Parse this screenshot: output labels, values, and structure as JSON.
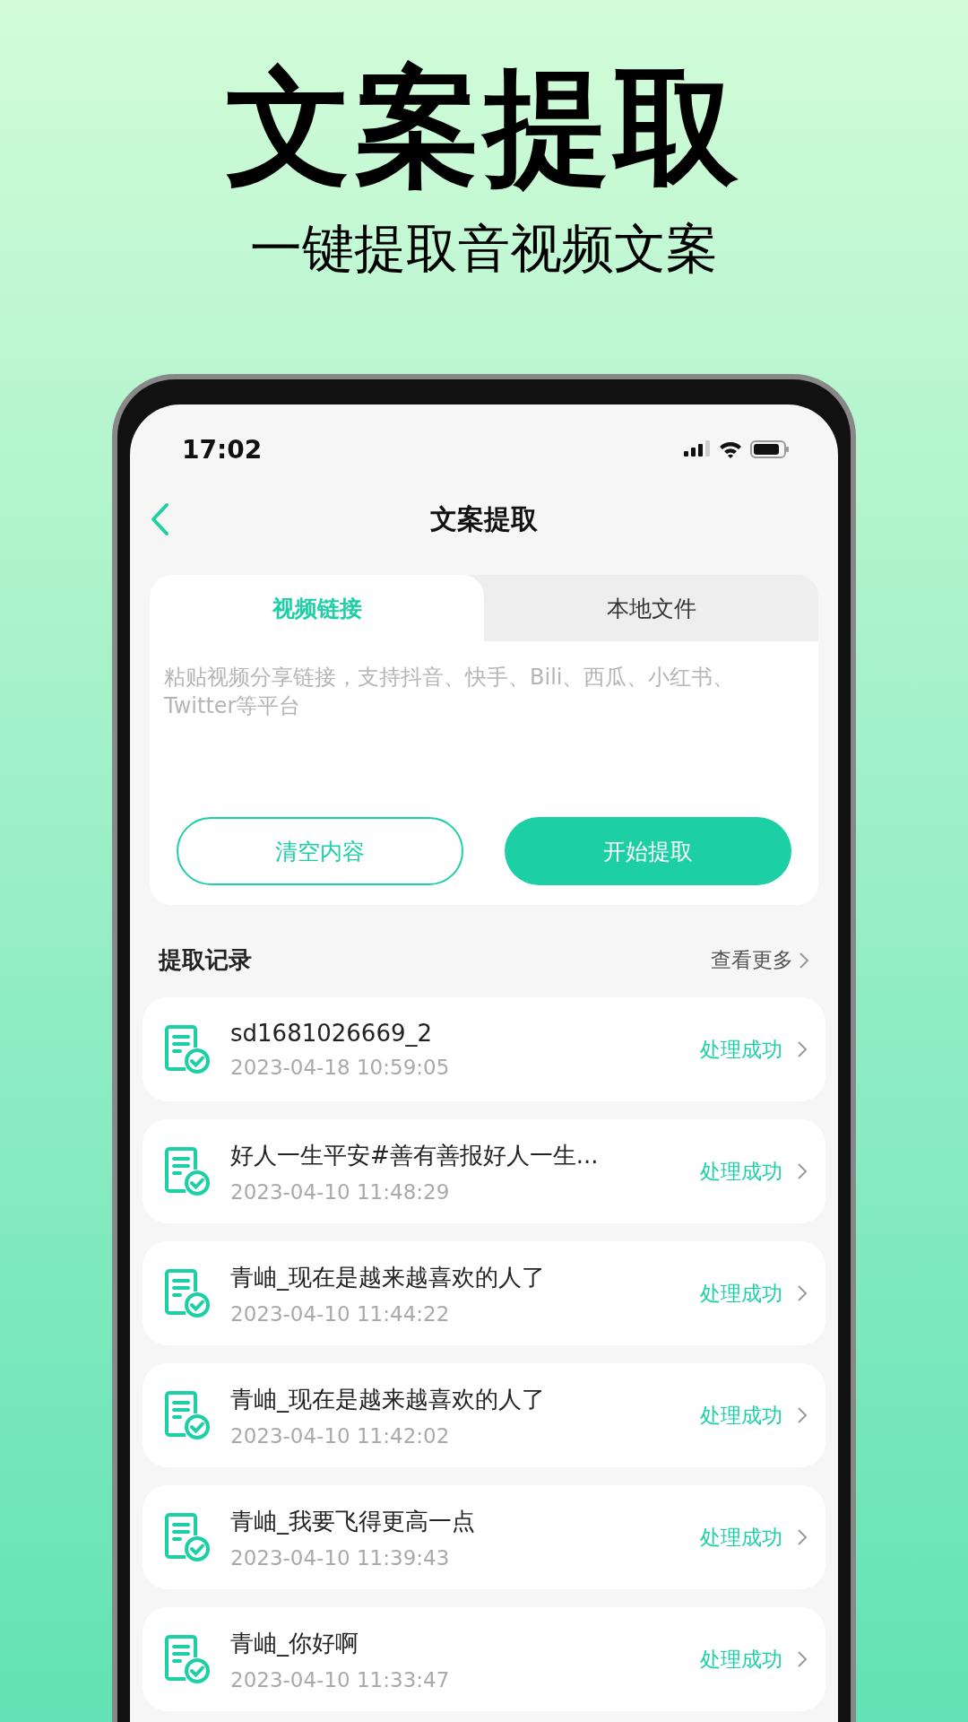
{
  "promo": {
    "headline": "文案提取",
    "subtitle": "一键提取音视频文案"
  },
  "status_bar": {
    "time": "17:02"
  },
  "nav": {
    "title": "文案提取"
  },
  "tabs": [
    {
      "label": "视频链接",
      "selected": true
    },
    {
      "label": "本地文件",
      "selected": false
    }
  ],
  "link_input": {
    "placeholder": "粘贴视频分享链接，支持抖音、快手、Bili、西瓜、小红书、Twitter等平台"
  },
  "buttons": [
    {
      "label": "清空内容",
      "kind": "outline"
    },
    {
      "label": "开始提取",
      "kind": "primary"
    }
  ],
  "records": {
    "title": "提取记录",
    "more": "查看更多",
    "items": [
      {
        "title": "sd1681026669_2",
        "time": "2023-04-18 10:59:05",
        "status": "处理成功"
      },
      {
        "title": "好人一生平安#善有善报好人一生...",
        "time": "2023-04-10 11:48:29",
        "status": "处理成功"
      },
      {
        "title": "青岫_现在是越来越喜欢的人了",
        "time": "2023-04-10 11:44:22",
        "status": "处理成功"
      },
      {
        "title": "青岫_现在是越来越喜欢的人了",
        "time": "2023-04-10 11:42:02",
        "status": "处理成功"
      },
      {
        "title": "青岫_我要飞得更高一点",
        "time": "2023-04-10 11:39:43",
        "status": "处理成功"
      },
      {
        "title": "青岫_你好啊",
        "time": "2023-04-10 11:33:47",
        "status": "处理成功"
      }
    ]
  }
}
